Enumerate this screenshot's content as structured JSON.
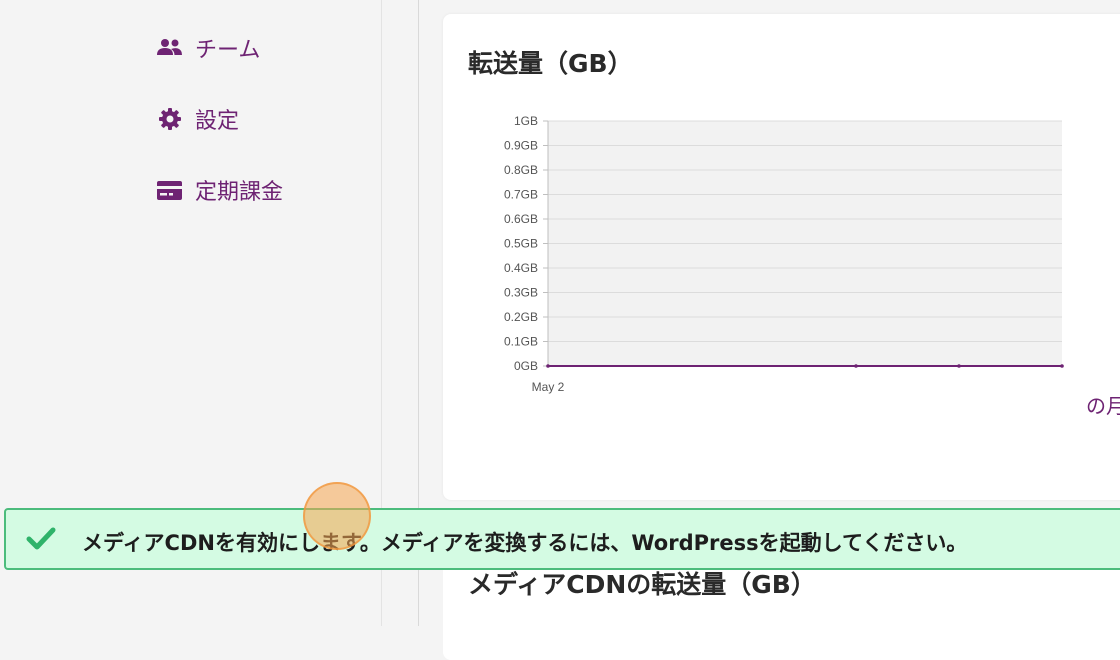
{
  "sidebar": {
    "items": [
      {
        "label": "チーム",
        "icon": "users-icon"
      },
      {
        "label": "設定",
        "icon": "gear-icon"
      },
      {
        "label": "定期課金",
        "icon": "credit-card-icon"
      }
    ]
  },
  "main": {
    "bandwidth_card": {
      "title": "転送量（GB）",
      "month_text": "の月"
    },
    "cdn_card": {
      "title": "メディアCDNの転送量（GB）"
    }
  },
  "chart_data": {
    "type": "line",
    "x": [
      "May 2"
    ],
    "y_ticks": [
      "1GB",
      "0.9GB",
      "0.8GB",
      "0.7GB",
      "0.6GB",
      "0.5GB",
      "0.4GB",
      "0.3GB",
      "0.2GB",
      "0.1GB",
      "0GB"
    ],
    "ylim": [
      0,
      1
    ],
    "series": [
      {
        "values": [
          0,
          0,
          0,
          0
        ]
      }
    ],
    "grid": true,
    "color": "#6e2373"
  },
  "toast": {
    "message": "メディアCDNを有効にします。メディアを変換するには、WordPressを起動してください。",
    "icon": "check-icon",
    "color": "#2fb36a"
  },
  "colors": {
    "accent": "#6e2373",
    "success_bg": "#d4fbe3",
    "success_border": "#4cbc7c"
  }
}
